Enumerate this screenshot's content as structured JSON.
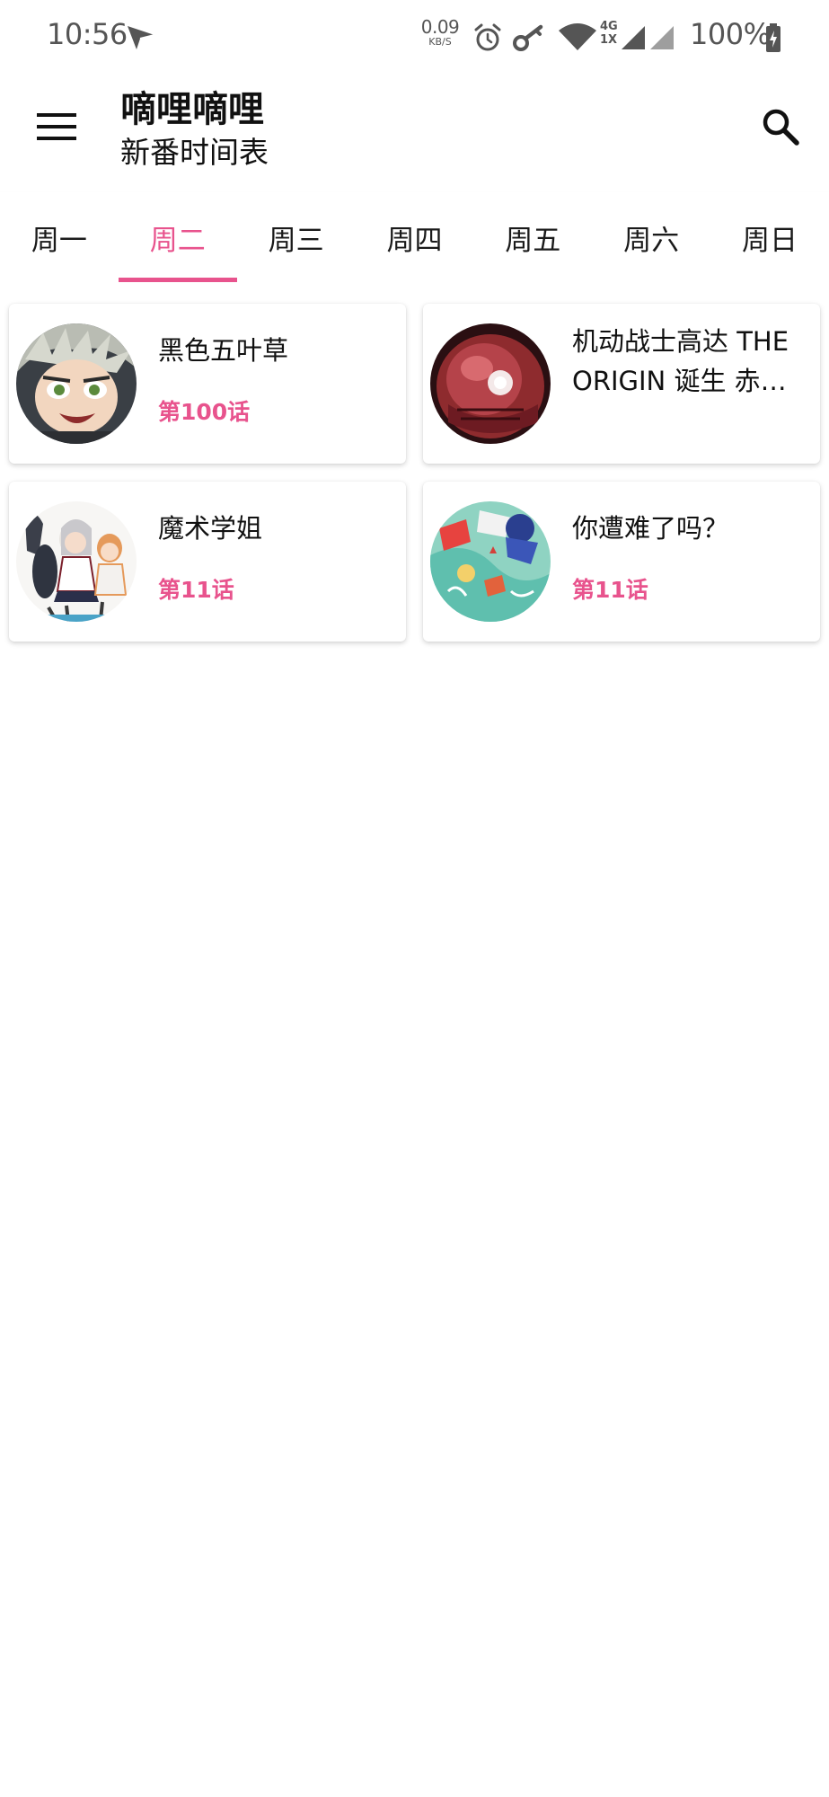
{
  "status_bar": {
    "time": "10:56",
    "net_speed": "0.09",
    "net_speed_unit": "KB/S",
    "network_type": "4G",
    "network_sub": "1X",
    "battery": "100%",
    "icons": [
      "send-icon",
      "alarm-icon",
      "vpn-key-icon",
      "wifi-icon",
      "signal-icon",
      "battery-charging-icon"
    ]
  },
  "app_bar": {
    "title": "嘀哩嘀哩",
    "subtitle": "新番时间表",
    "menu_icon": "menu-icon",
    "search_icon": "search-icon"
  },
  "tabs": [
    {
      "label": "周一"
    },
    {
      "label": "周二",
      "active": true
    },
    {
      "label": "周三"
    },
    {
      "label": "周四"
    },
    {
      "label": "周五"
    },
    {
      "label": "周六"
    },
    {
      "label": "周日"
    }
  ],
  "colors": {
    "accent": "#e8538d",
    "text": "#111111",
    "status_text": "#555555",
    "background": "#ffffff"
  },
  "schedule": [
    {
      "title": "黑色五叶草",
      "episode": "第100话"
    },
    {
      "title": "机动战士高达 THE ORIGIN 诞生 赤…",
      "episode": ""
    },
    {
      "title": "魔术学姐",
      "episode": "第11话"
    },
    {
      "title": "你遭难了吗？",
      "episode": "第11话"
    }
  ]
}
